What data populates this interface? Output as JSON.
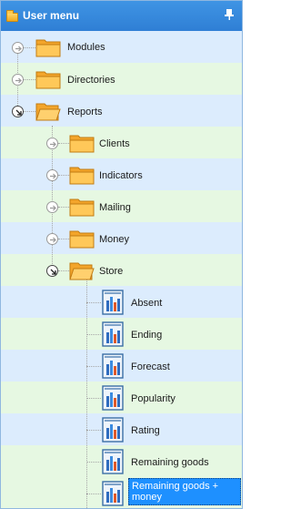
{
  "panel": {
    "title": "User menu",
    "title_icon": "folder-icon",
    "pin_icon": "pin-icon"
  },
  "tree": {
    "modules": "Modules",
    "directories": "Directories",
    "reports": "Reports",
    "clients": "Clients",
    "indicators": "Indicators",
    "mailing": "Mailing",
    "money": "Money",
    "store": "Store",
    "absent": "Absent",
    "ending": "Ending",
    "forecast": "Forecast",
    "popularity": "Popularity",
    "rating": "Rating",
    "remaining_goods": "Remaining goods",
    "remaining_goods_money": "Remaining goods + money"
  },
  "colors": {
    "title_bar": "#2f7fd5",
    "row_blue": "#dcecfd",
    "row_green": "#e6f8e2",
    "selection": "#1e90ff"
  }
}
